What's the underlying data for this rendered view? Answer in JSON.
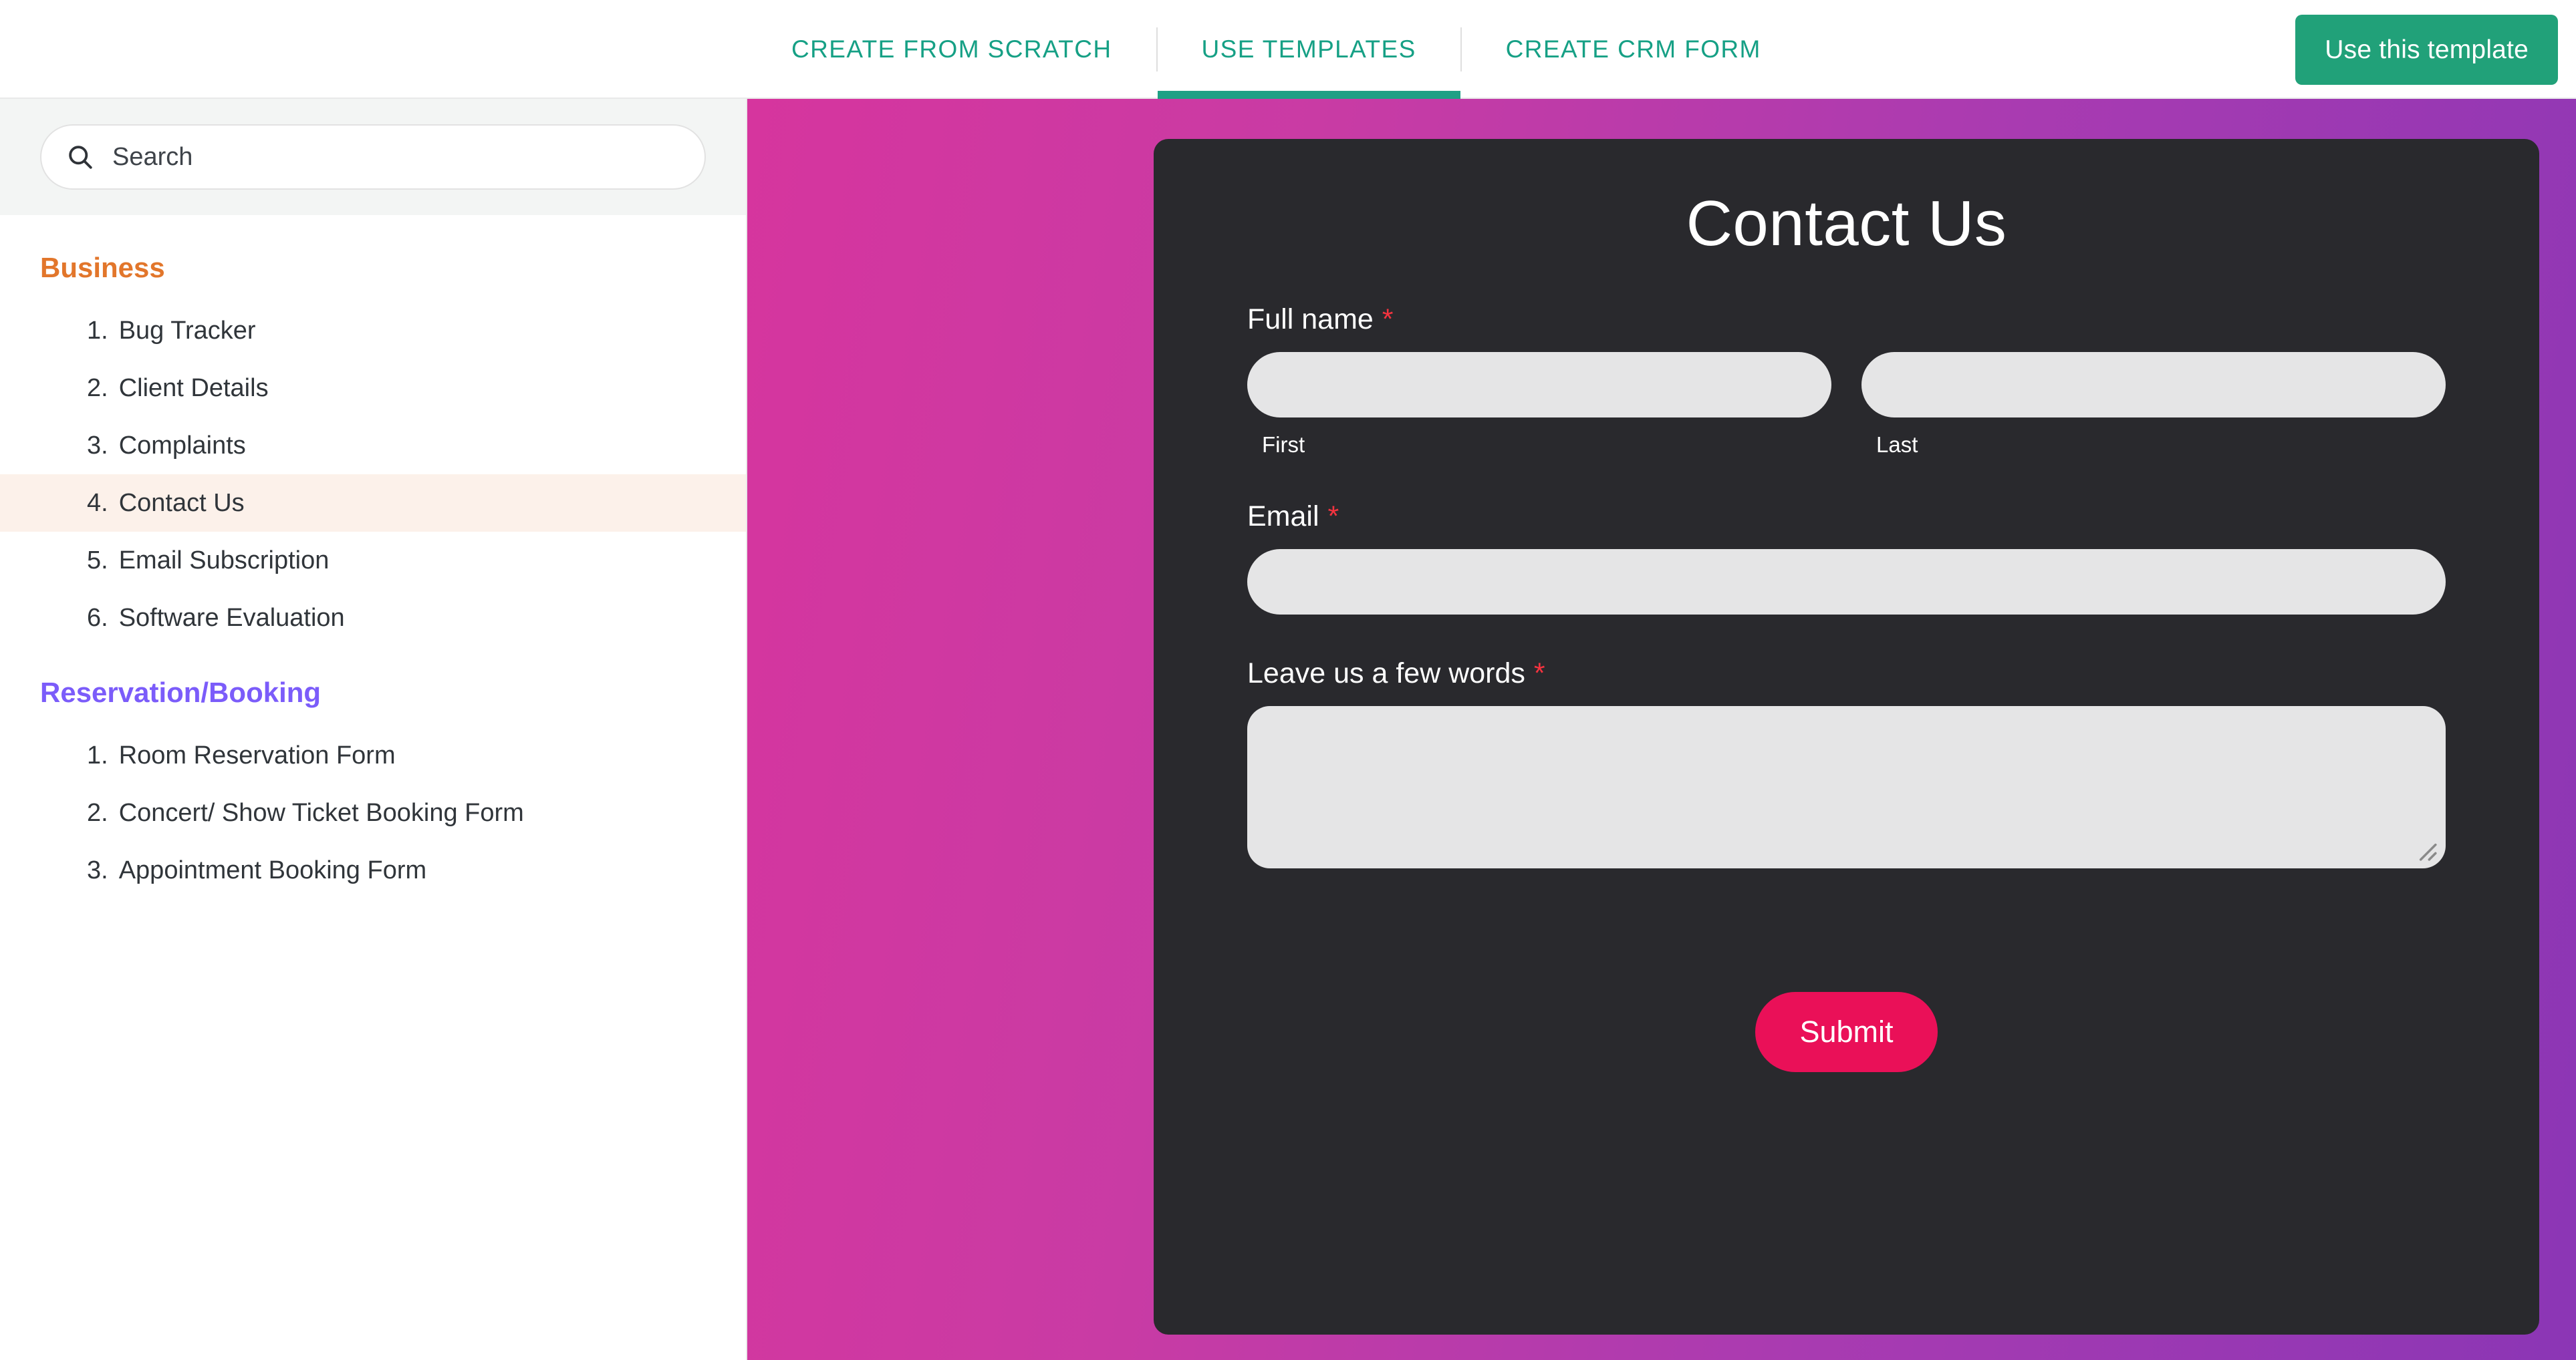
{
  "topbar": {
    "tabs": [
      {
        "label": "CREATE FROM SCRATCH",
        "active": false
      },
      {
        "label": "USE TEMPLATES",
        "active": true
      },
      {
        "label": "CREATE CRM FORM",
        "active": false
      }
    ],
    "use_template_button": "Use this template",
    "accent_green": "#21a179",
    "tab_color": "#16a085",
    "active_underline": "#1fa085"
  },
  "sidebar": {
    "search": {
      "placeholder": "Search",
      "value": "",
      "icon": "search-icon"
    },
    "groups": [
      {
        "title": "Business",
        "color": "#e2762b",
        "items": [
          {
            "index": "1.",
            "label": "Bug Tracker",
            "active": false
          },
          {
            "index": "2.",
            "label": "Client Details",
            "active": false
          },
          {
            "index": "3.",
            "label": "Complaints",
            "active": false
          },
          {
            "index": "4.",
            "label": "Contact Us",
            "active": true
          },
          {
            "index": "5.",
            "label": "Email Subscription",
            "active": false
          },
          {
            "index": "6.",
            "label": "Software Evaluation",
            "active": false
          }
        ]
      },
      {
        "title": "Reservation/Booking",
        "color": "#7b5cfa",
        "items": [
          {
            "index": "1.",
            "label": "Room Reservation Form",
            "active": false
          },
          {
            "index": "2.",
            "label": "Concert/ Show Ticket Booking Form",
            "active": false
          },
          {
            "index": "3.",
            "label": "Appointment Booking Form",
            "active": false
          }
        ]
      }
    ],
    "active_item_background": "#fcf1ea"
  },
  "preview": {
    "background_gradient_from": "#d6359e",
    "background_gradient_to": "#8b36b5",
    "form": {
      "card_background": "#29292d",
      "title": "Contact Us",
      "required_marker": "*",
      "fields": [
        {
          "type": "name",
          "label": "Full name",
          "required": true,
          "parts": [
            {
              "sub_label": "First",
              "value": "",
              "placeholder": ""
            },
            {
              "sub_label": "Last",
              "value": "",
              "placeholder": ""
            }
          ]
        },
        {
          "type": "email",
          "label": "Email",
          "required": true,
          "value": "",
          "placeholder": ""
        },
        {
          "type": "textarea",
          "label": "Leave us a few words",
          "required": true,
          "value": "",
          "placeholder": ""
        }
      ],
      "submit_label": "Submit",
      "submit_color": "#ea1058",
      "input_background": "#e5e5e6",
      "required_color": "#f5333f"
    }
  }
}
